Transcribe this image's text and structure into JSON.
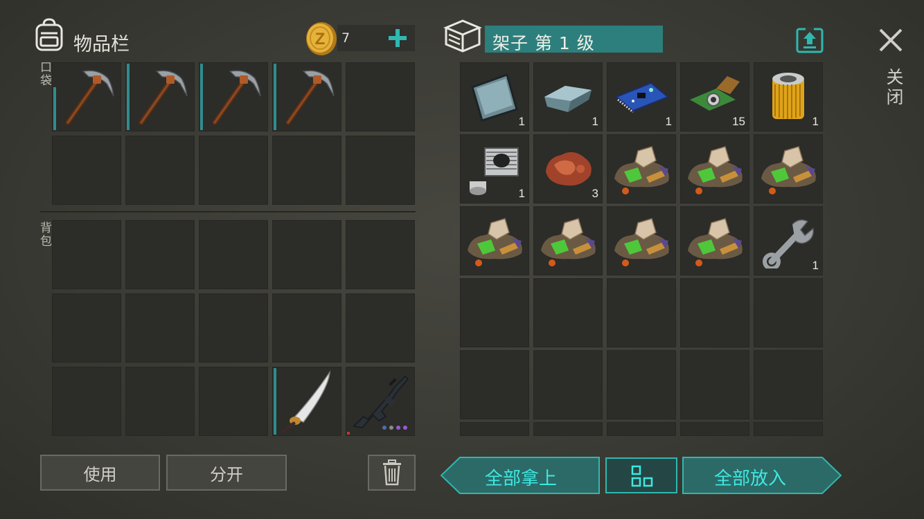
{
  "inventory": {
    "title": "物品栏",
    "coins": "7",
    "pockets_label": "口袋",
    "backpack_label": "背包",
    "use_button": "使用",
    "split_button": "分开"
  },
  "storage": {
    "title": "架子 第 1 级",
    "close_label": "关闭",
    "take_all_button": "全部拿上",
    "put_all_button": "全部放入",
    "items": [
      {
        "name": "metal-plate",
        "qty": "1"
      },
      {
        "name": "iron-bar",
        "qty": "1"
      },
      {
        "name": "circuit-board",
        "qty": "1"
      },
      {
        "name": "camera-module",
        "qty": "15"
      },
      {
        "name": "oil-filter",
        "qty": "1"
      },
      {
        "name": "engine-cylinder",
        "qty": "1"
      },
      {
        "name": "copper-ore",
        "qty": "3"
      },
      {
        "name": "mixed-resources",
        "qty": ""
      },
      {
        "name": "mixed-resources",
        "qty": ""
      },
      {
        "name": "mixed-resources",
        "qty": ""
      },
      {
        "name": "mixed-resources",
        "qty": ""
      },
      {
        "name": "mixed-resources",
        "qty": ""
      },
      {
        "name": "mixed-resources",
        "qty": ""
      },
      {
        "name": "mixed-resources",
        "qty": ""
      },
      {
        "name": "wrench",
        "qty": "1"
      }
    ]
  },
  "colors": {
    "accent": "#2fb8b0",
    "accent_text": "#3fe8e0",
    "slot": "#2c2c29"
  }
}
